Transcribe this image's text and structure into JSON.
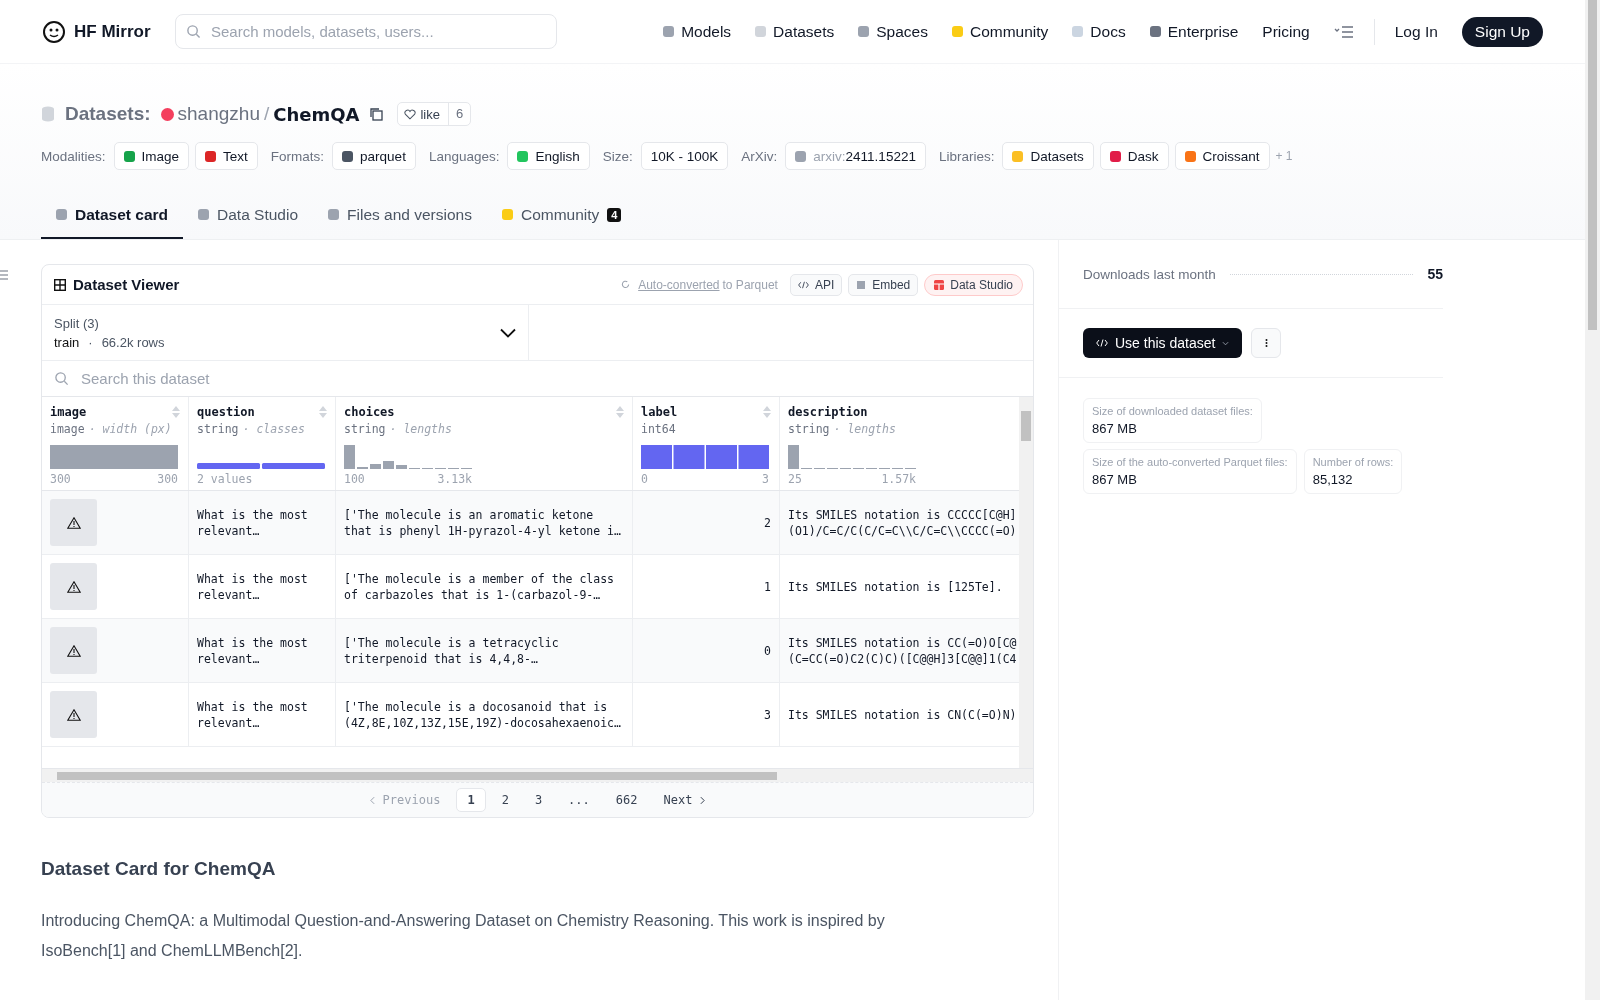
{
  "header": {
    "logo": "HF Mirror",
    "search": {
      "placeholder": "Search models, datasets, users..."
    },
    "nav": [
      {
        "label": "Models",
        "color": "#9ca3af"
      },
      {
        "label": "Datasets",
        "color": "#d1d5db"
      },
      {
        "label": "Spaces",
        "color": "#9ca3af"
      },
      {
        "label": "Community",
        "color": "#facc15"
      },
      {
        "label": "Docs",
        "color": "#cbd5e1"
      },
      {
        "label": "Enterprise",
        "color": "#6b7280"
      },
      {
        "label": "Pricing"
      }
    ],
    "login": "Log In",
    "signup": "Sign Up"
  },
  "title": {
    "prefix": "Datasets:",
    "owner": "shangzhu",
    "separator": "/",
    "name": "ChemQA",
    "like": "like",
    "likes": "6"
  },
  "tags": [
    {
      "label": "Modalities:",
      "chips": [
        {
          "text": "Image",
          "color": "#16a34a"
        },
        {
          "text": "Text",
          "color": "#dc2626"
        }
      ]
    },
    {
      "label": "Formats:",
      "chips": [
        {
          "text": "parquet",
          "color": "#4b5563"
        }
      ]
    },
    {
      "label": "Languages:",
      "chips": [
        {
          "text": "English",
          "color": "#22c55e"
        }
      ]
    },
    {
      "label": "Size:",
      "chips": [
        {
          "text": "10K - 100K"
        }
      ]
    },
    {
      "label": "ArXiv:",
      "chips": [
        {
          "prefix": "arxiv:",
          "text": "2411.15221",
          "color": "#9ca3af"
        }
      ]
    },
    {
      "label": "Libraries:",
      "chips": [
        {
          "text": "Datasets",
          "color": "#fbbf24"
        },
        {
          "text": "Dask",
          "color": "#e11d48"
        },
        {
          "text": "Croissant",
          "color": "#f97316"
        }
      ],
      "more": "+ 1"
    }
  ],
  "tabs": [
    {
      "label": "Dataset card",
      "selected": true,
      "color": "#9ca3af"
    },
    {
      "label": "Data Studio",
      "selected": false,
      "color": "#9ca3af"
    },
    {
      "label": "Files and versions",
      "selected": false,
      "color": "#9ca3af"
    },
    {
      "label": "Community",
      "selected": false,
      "color": "#facc15",
      "count": "4"
    }
  ],
  "viewer": {
    "title": "Dataset Viewer",
    "converted_link": "Auto-converted",
    "converted_rest": "to Parquet",
    "buttons": [
      {
        "label": "API",
        "kind": "api"
      },
      {
        "label": "Embed",
        "kind": "embed"
      },
      {
        "label": "Data Studio",
        "kind": "studio"
      }
    ],
    "split": {
      "label": "Split (3)",
      "name": "train",
      "separator": "·",
      "rows": "66.2k rows"
    },
    "search": {
      "placeholder": "Search this dataset"
    },
    "columns": [
      {
        "name": "image",
        "type": "image",
        "stat": "· width (px)",
        "kind": "width",
        "min": "300",
        "max": "300"
      },
      {
        "name": "question",
        "type": "string",
        "stat": "· classes",
        "kind": "classes",
        "min": "2 values"
      },
      {
        "name": "choices",
        "type": "string",
        "stat": "· lengths",
        "kind": "lengths",
        "min": "100",
        "max": "3.13k"
      },
      {
        "name": "label",
        "type": "int64",
        "kind": "int",
        "min": "0",
        "max": "3"
      },
      {
        "name": "description",
        "type": "string",
        "stat": "· lengths",
        "kind": "lengths2",
        "min": "25",
        "max": "1.57k"
      }
    ],
    "rows": [
      {
        "question": [
          "What is the most",
          "relevant…"
        ],
        "choices": [
          "['The molecule is an aromatic ketone",
          "that is phenyl 1H-pyrazol-4-yl ketone i…"
        ],
        "label": "2",
        "description": [
          "Its SMILES notation is CCCCC[C@H]",
          "(O1)/C=C/C(C/C=C\\\\C/C=C\\\\CCCC(=O)"
        ]
      },
      {
        "question": [
          "What is the most",
          "relevant…"
        ],
        "choices": [
          "['The molecule is a member of the class",
          "of carbazoles that is 1-(carbazol-9-…"
        ],
        "label": "1",
        "description": [
          "Its SMILES notation is [125Te]."
        ]
      },
      {
        "question": [
          "What is the most",
          "relevant…"
        ],
        "choices": [
          "['The molecule is a tetracyclic",
          "triterpenoid that is 4,4,8-…"
        ],
        "label": "0",
        "description": [
          "Its SMILES notation is CC(=O)O[C@",
          "(C=CC(=O)C2(C)C)([C@@H]3[C@@]1(C4"
        ]
      },
      {
        "question": [
          "What is the most",
          "relevant…"
        ],
        "choices": [
          "['The molecule is a docosanoid that is",
          "(4Z,8E,10Z,13Z,15E,19Z)-docosahexaenoic…"
        ],
        "label": "3",
        "description": [
          "Its SMILES notation is CN(C(=O)N)"
        ]
      }
    ],
    "pagination": {
      "previous": "Previous",
      "next": "Next",
      "pages": [
        {
          "label": "1",
          "selected": true
        },
        {
          "label": "2",
          "selected": false
        },
        {
          "label": "3",
          "selected": false
        },
        {
          "label": "...",
          "selected": false
        },
        {
          "label": "662",
          "selected": false
        }
      ]
    }
  },
  "card": {
    "heading": "Dataset Card for ChemQA",
    "paragraph": "Introducing ChemQA: a Multimodal Question-and-Answering Dataset on Chemistry Reasoning. This work is inspired by IsoBench[1] and ChemLLMBench[2]."
  },
  "sidebar": {
    "downloads_label": "Downloads last month",
    "downloads": "55",
    "use_button": "Use this dataset",
    "stats": [
      {
        "label": "Size of downloaded dataset files:",
        "value": "867 MB"
      },
      {
        "label": "Size of the auto-converted Parquet files:",
        "value": "867 MB"
      },
      {
        "label": "Number of rows:",
        "value": "85,132"
      }
    ]
  }
}
